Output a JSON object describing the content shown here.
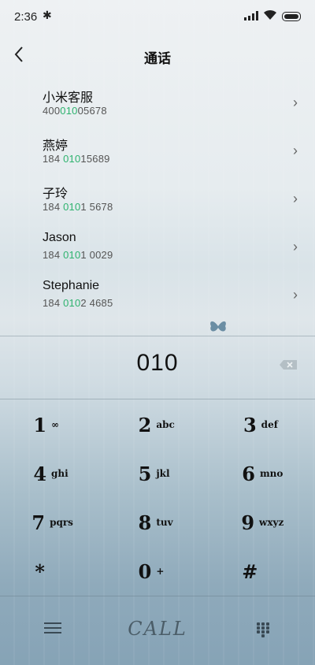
{
  "status_bar": {
    "time": "2:36",
    "bluetooth_icon": "bluetooth-icon",
    "signal_icon": "signal-icon",
    "wifi_icon": "wifi-icon",
    "battery_icon": "battery-icon"
  },
  "header": {
    "title": "通话",
    "back_icon": "back-chevron-icon"
  },
  "contacts": [
    {
      "name": "小米客服",
      "num_pre": "400",
      "num_hl": "010",
      "num_post": "05678"
    },
    {
      "name": "燕婷",
      "num_pre": "184 ",
      "num_hl": "010",
      "num_post": "15689"
    },
    {
      "name": "子玲",
      "num_pre": "184 ",
      "num_hl": "010",
      "num_post": "1 5678"
    },
    {
      "name": "Jason",
      "num_pre": "184 ",
      "num_hl": "010",
      "num_post": "1 0029"
    },
    {
      "name": "Stephanie",
      "num_pre": "184 ",
      "num_hl": "010",
      "num_post": "2 4685"
    }
  ],
  "dial": {
    "digits": "010",
    "delete_icon": "backspace-icon"
  },
  "keys": [
    [
      {
        "d": "1",
        "l": "∞"
      },
      {
        "d": "2",
        "l": "abc"
      },
      {
        "d": "3",
        "l": "def"
      }
    ],
    [
      {
        "d": "4",
        "l": "ghi"
      },
      {
        "d": "5",
        "l": "jkl"
      },
      {
        "d": "6",
        "l": "mno"
      }
    ],
    [
      {
        "d": "7",
        "l": "pqrs"
      },
      {
        "d": "8",
        "l": "tuv"
      },
      {
        "d": "9",
        "l": "wxyz"
      }
    ],
    [
      {
        "d": "*",
        "l": ""
      },
      {
        "d": "0",
        "l": "+"
      },
      {
        "d": "#",
        "l": ""
      }
    ]
  ],
  "bottom": {
    "menu_icon": "menu-icon",
    "call_label": "CALL",
    "grid_icon": "keypad-grid-icon"
  },
  "colors": {
    "highlight": "#2fb36f"
  }
}
